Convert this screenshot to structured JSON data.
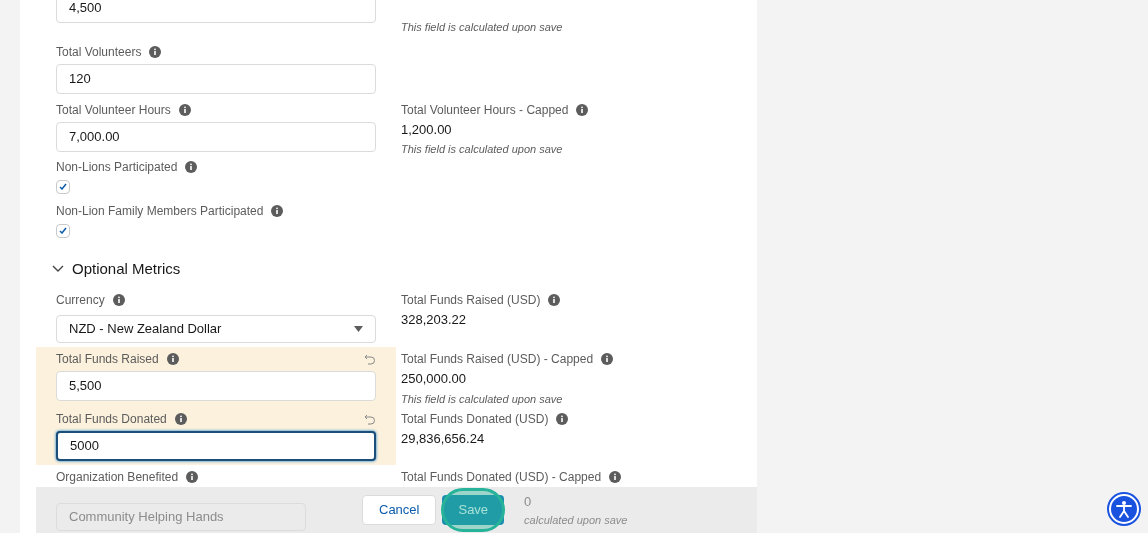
{
  "top_partial": {
    "value": "4,500",
    "note": "This field is calculated upon save"
  },
  "fields": [
    {
      "left": {
        "kind": "input",
        "label": "Total Volunteers",
        "value": "120",
        "edited": false,
        "focused": false
      }
    },
    {
      "left": {
        "kind": "input",
        "label": "Total Volunteer Hours",
        "value": "7,000.00",
        "edited": false,
        "focused": false
      },
      "right": {
        "label": "Total Volunteer Hours - Capped",
        "value": "1,200.00",
        "note": "This field is calculated upon save"
      }
    },
    {
      "left": {
        "kind": "checkbox",
        "label": "Non-Lions Participated",
        "checked": true
      }
    },
    {
      "left": {
        "kind": "checkbox",
        "label": "Non-Lion Family Members Participated",
        "checked": true
      }
    }
  ],
  "section": {
    "title": "Optional Metrics",
    "expanded": true
  },
  "metrics": [
    {
      "left": {
        "kind": "select",
        "label": "Currency",
        "value": "NZD - New Zealand Dollar"
      },
      "right": {
        "label": "Total Funds Raised (USD)",
        "value": "328,203.22"
      }
    },
    {
      "left": {
        "kind": "input",
        "label": "Total Funds Raised",
        "value": "5,500",
        "edited": true,
        "focused": false
      },
      "right": {
        "label": "Total Funds Raised (USD) - Capped",
        "value": "250,000.00",
        "note": "This field is calculated upon save"
      }
    },
    {
      "left": {
        "kind": "input",
        "label": "Total Funds Donated",
        "value": "5000",
        "edited": true,
        "focused": true
      },
      "right": {
        "label": "Total Funds Donated (USD)",
        "value": "29,836,656.24"
      }
    },
    {
      "left": {
        "kind": "label",
        "label": "Organization Benefited"
      },
      "right": {
        "label": "Total Funds Donated (USD) - Capped"
      }
    }
  ],
  "footer": {
    "field_value": "Community Helping Hands",
    "capped_value": "0",
    "capped_note": "calculated upon save",
    "buttons": [
      {
        "label": "Cancel",
        "kind": "neutral"
      },
      {
        "label": "Save",
        "kind": "brand",
        "highlighted": true
      }
    ]
  }
}
